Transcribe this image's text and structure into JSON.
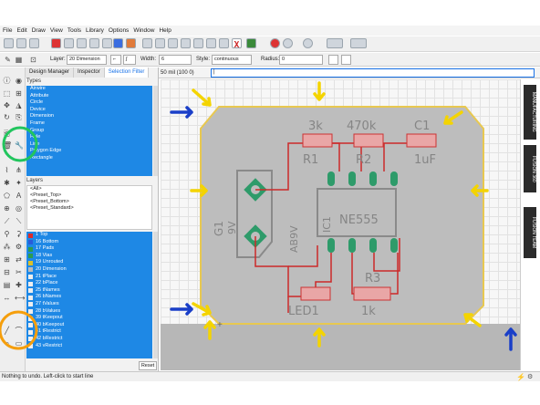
{
  "menu": [
    "File",
    "Edit",
    "Draw",
    "View",
    "Tools",
    "Library",
    "Options",
    "Window",
    "Help"
  ],
  "toolbar2": {
    "layer_label": "Layer:",
    "layer_value": "20 Dimension",
    "width_label": "Width:",
    "width_value": "6",
    "style_label": "Style:",
    "style_value": "continuous",
    "radius_label": "Radius:",
    "radius_value": "0"
  },
  "panel": {
    "tabs": [
      "Design Manager",
      "Inspector",
      "Selection Filter"
    ],
    "types_label": "Types",
    "types": [
      "Airwire",
      "Attribute",
      "Circle",
      "Device",
      "Dimension",
      "Frame",
      "Group",
      "Hole",
      "Line",
      "Polygon Edge",
      "Rectangle"
    ],
    "layers_label": "Layers",
    "presets": [
      "<All>",
      "<Preset_Top>",
      "<Preset_Bottom>",
      "<Preset_Standard>"
    ],
    "layers": [
      {
        "name": "1 Top",
        "color": "#d92b2b"
      },
      {
        "name": "16 Bottom",
        "color": "#2b5bd9"
      },
      {
        "name": "17 Pads",
        "color": "#2e9b4f"
      },
      {
        "name": "18 Vias",
        "color": "#2e9b4f"
      },
      {
        "name": "19 Unrouted",
        "color": "#d9c02b"
      },
      {
        "name": "20 Dimension",
        "color": "#bbbbbb"
      },
      {
        "name": "21 tPlace",
        "color": "#eeeeee"
      },
      {
        "name": "22 bPlace",
        "color": "#eeeeee"
      },
      {
        "name": "25 tNames",
        "color": "#eeeeee"
      },
      {
        "name": "26 bNames",
        "color": "#eeeeee"
      },
      {
        "name": "27 tValues",
        "color": "#eeeeee"
      },
      {
        "name": "28 bValues",
        "color": "#eeeeee"
      },
      {
        "name": "39 tKeepout",
        "color": "#eeeeee"
      },
      {
        "name": "40 bKeepout",
        "color": "#eeeeee"
      },
      {
        "name": "41 tRestrict",
        "color": "#eeeeee"
      },
      {
        "name": "42 bRestrict",
        "color": "#eeeeee"
      },
      {
        "name": "43 vRestrict",
        "color": "#eeeeee"
      }
    ],
    "reset_label": "Reset"
  },
  "coordinates": "50 mil (100 0)",
  "command_value": "|",
  "board": {
    "labels": {
      "r1_value": "3k",
      "r2_value": "470k",
      "c1_name": "C1",
      "r1_name": "R1",
      "r2_name": "R2",
      "c1_value": "1uF",
      "ic_name": "NE555",
      "ic_ref": "IC1",
      "g1": "G1",
      "v9": "9V",
      "ab9v": "AB9V",
      "r3_name": "R3",
      "led_name": "LED1",
      "r3_value": "1k"
    }
  },
  "right_panel": [
    "MANUFACTURING",
    "FUSION 360",
    "FUSION TEAM"
  ],
  "status": "Nothing to undo. Left-click to start line",
  "colors": {
    "accent": "#1e88e5",
    "board_outline": "#e8c850",
    "annotation_yellow": "#f4d400",
    "annotation_blue": "#1a3fc8",
    "circle_green": "#22c55e",
    "circle_orange": "#f59e0b"
  }
}
